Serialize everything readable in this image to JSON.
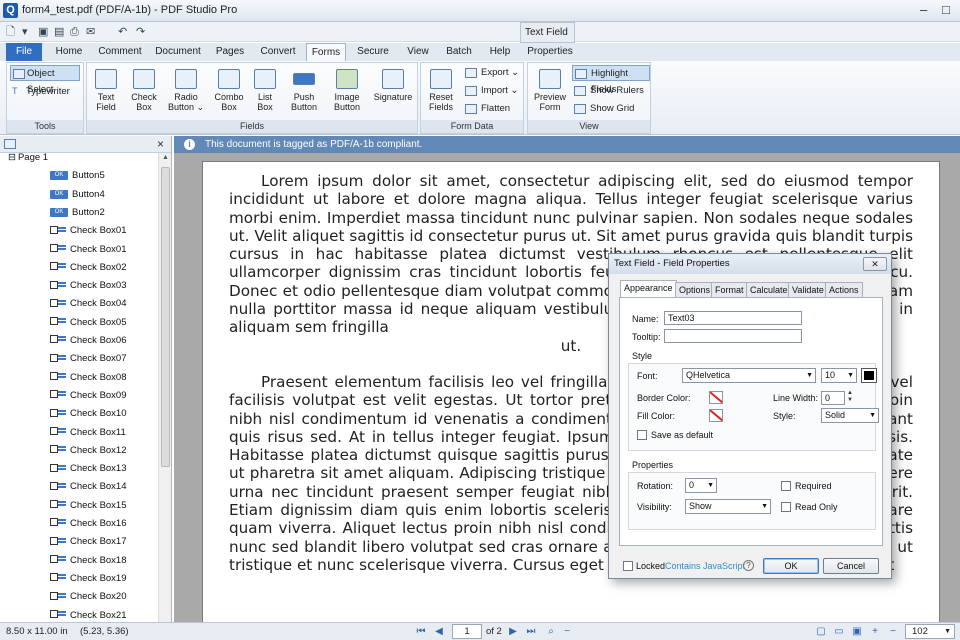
{
  "window": {
    "app_icon_letter": "Q",
    "title": "form4_test.pdf (PDF/A-1b) - PDF Studio Pro",
    "minimize": "–",
    "maximize": "□"
  },
  "context_header": "Text Field",
  "tabs": [
    "File",
    "Home",
    "Comment",
    "Document",
    "Pages",
    "Convert",
    "Forms",
    "Secure",
    "View",
    "Batch",
    "Help",
    "Properties"
  ],
  "active_tab": "Forms",
  "ribbon": {
    "tools": {
      "label": "Tools",
      "object_select": "Object Select",
      "typewriter": "Typewriter"
    },
    "fields": {
      "label": "Fields",
      "buttons": [
        {
          "l1": "Text",
          "l2": "Field"
        },
        {
          "l1": "Check",
          "l2": "Box"
        },
        {
          "l1": "Radio",
          "l2": "Button ⌄"
        },
        {
          "l1": "Combo",
          "l2": "Box"
        },
        {
          "l1": "List",
          "l2": "Box"
        },
        {
          "l1": "Push",
          "l2": "Button"
        },
        {
          "l1": "Image",
          "l2": "Button"
        },
        {
          "l1": "Signature",
          "l2": ""
        }
      ]
    },
    "form_data": {
      "label": "Form Data",
      "reset1": "Reset",
      "reset2": "Fields",
      "export": "Export ⌄",
      "import": "Import ⌄",
      "flatten": "Flatten"
    },
    "view": {
      "label": "View",
      "preview1": "Preview",
      "preview2": "Form",
      "highlight": "Highlight Fields",
      "rulers": "Show Rulers",
      "grid": "Show Grid"
    }
  },
  "left_pane": {
    "close": "×",
    "tree": [
      {
        "type": "page",
        "label": "Page 1"
      },
      {
        "type": "button",
        "label": "Button5"
      },
      {
        "type": "button",
        "label": "Button4"
      },
      {
        "type": "button",
        "label": "Button2"
      },
      {
        "type": "check",
        "label": "Check Box01"
      },
      {
        "type": "check",
        "label": "Check Box01"
      },
      {
        "type": "check",
        "label": "Check Box02"
      },
      {
        "type": "check",
        "label": "Check Box03"
      },
      {
        "type": "check",
        "label": "Check Box04"
      },
      {
        "type": "check",
        "label": "Check Box05"
      },
      {
        "type": "check",
        "label": "Check Box06"
      },
      {
        "type": "check",
        "label": "Check Box07"
      },
      {
        "type": "check",
        "label": "Check Box08"
      },
      {
        "type": "check",
        "label": "Check Box09"
      },
      {
        "type": "check",
        "label": "Check Box10"
      },
      {
        "type": "check",
        "label": "Check Box11"
      },
      {
        "type": "check",
        "label": "Check Box12"
      },
      {
        "type": "check",
        "label": "Check Box13"
      },
      {
        "type": "check",
        "label": "Check Box14"
      },
      {
        "type": "check",
        "label": "Check Box15"
      },
      {
        "type": "check",
        "label": "Check Box16"
      },
      {
        "type": "check",
        "label": "Check Box17"
      },
      {
        "type": "check",
        "label": "Check Box18"
      },
      {
        "type": "check",
        "label": "Check Box19"
      },
      {
        "type": "check",
        "label": "Check Box20"
      },
      {
        "type": "check",
        "label": "Check Box21"
      }
    ]
  },
  "infobar": {
    "icon": "i",
    "message": "This document is tagged as PDF/A-1b compliant."
  },
  "document": {
    "para1": "Lorem ipsum dolor sit amet, consectetur adipiscing elit, sed do eiusmod tempor incididunt ut labore et dolore magna aliqua. Tellus integer feugiat scelerisque varius morbi enim. Imperdiet massa tincidunt nunc pulvinar sapien. Non sodales neque sodales ut. Velit aliquet sagittis id consectetur purus ut. Sit amet purus gravida quis blandit turpis cursus in hac habitasse platea dictumst vestibulum rhoncus est pellentesque elit ullamcorper dignissim cras tincidunt lobortis feugiat id. Vivamus at augue eget arcu. Donec et odio pellentesque diam volutpat commodo sed egestas egestas. Ut diam quam nulla porttitor massa id neque aliquam vestibulum. Nunc scelerisque viverra mauris in aliquam sem fringilla",
    "para1_end": "ut.",
    "para2": "Praesent elementum facilisis leo vel fringilla est ullamcorper eget nulla facilisis vel facilisis volutpat est velit egestas. Ut tortor pretium viverra suspendisse potenti. Proin nibh nisl condimentum id venenatis a condimentum vitae sapien pellentesque habitant quis risus sed. At in tellus integer feugiat. Ipsum nunc aliquet bibendum enim facilisis. Habitasse platea dictumst quisque sagittis purus sit amet volutpat consequat vulputate ut pharetra sit amet aliquam. Adipiscing tristique risus nec feugiat in fermentum posuere urna nec tincidunt praesent semper feugiat nibh sed pulvinar proin gravida hendrerit. Etiam dignissim diam quis enim lobortis scelerisque fermentum dui faucibus in ornare quam viverra. Aliquet lectus proin nibh nisl condimentum id venenatis a pulvinar mattis nunc sed blandit libero volutpat sed cras ornare arcu dui vivamus arcu felis bibendum ut tristique et nunc scelerisque viverra. Cursus eget nunc scelerisque viverra mauris. Velit"
  },
  "status": {
    "size": "8.50 x 11.00 in",
    "coords": "(5.23, 5.36)",
    "page": "1",
    "of_pages": "of 2",
    "zoom": "102"
  },
  "dialog": {
    "title": "Text Field - Field Properties",
    "close": "✕",
    "tabs": [
      "Appearance",
      "Options",
      "Format",
      "Calculate",
      "Validate",
      "Actions"
    ],
    "name_label": "Name:",
    "name_value": "Text03",
    "tooltip_label": "Tooltip:",
    "tooltip_value": "",
    "style_section": "Style",
    "font_label": "Font:",
    "font_value": "QHelvetica",
    "font_size": "10",
    "border_color_label": "Border Color:",
    "fill_color_label": "Fill Color:",
    "line_width_label": "Line Width:",
    "line_width_value": "0",
    "style_label": "Style:",
    "style_value": "Solid",
    "save_default": "Save as default",
    "properties_section": "Properties",
    "rotation_label": "Rotation:",
    "rotation_value": "0",
    "visibility_label": "Visibility:",
    "visibility_value": "Show",
    "required": "Required",
    "read_only": "Read Only",
    "locked": "Locked",
    "contains_js": "Contains JavaScript",
    "ok": "OK",
    "cancel": "Cancel"
  }
}
